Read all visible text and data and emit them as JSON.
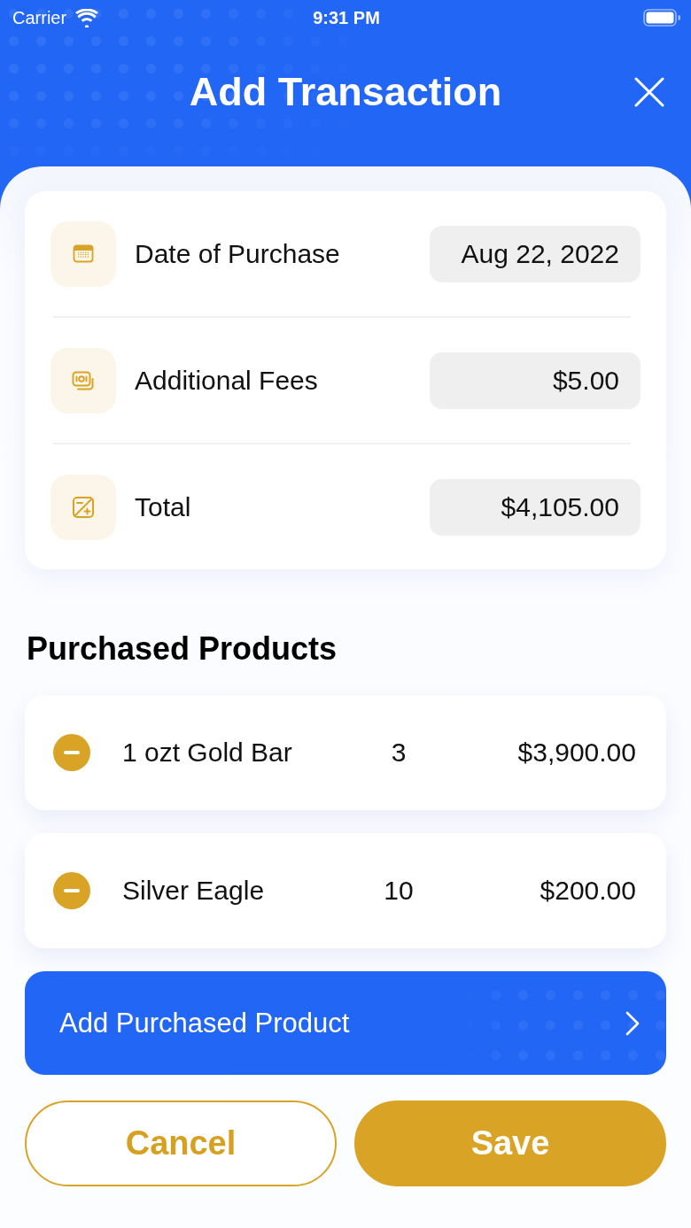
{
  "status_bar": {
    "carrier": "Carrier",
    "time": "9:31 PM"
  },
  "header": {
    "title": "Add Transaction"
  },
  "summary": [
    {
      "kind": "date",
      "label": "Date of Purchase",
      "value": "Aug 22, 2022"
    },
    {
      "kind": "fees",
      "label": "Additional Fees",
      "value": "$5.00"
    },
    {
      "kind": "total",
      "label": "Total",
      "value": "$4,105.00"
    }
  ],
  "products_section": {
    "title": "Purchased Products",
    "items": [
      {
        "name": "1 ozt Gold Bar",
        "quantity": "3",
        "price": "$3,900.00"
      },
      {
        "name": "Silver Eagle",
        "quantity": "10",
        "price": "$200.00"
      }
    ]
  },
  "add_button": {
    "label": "Add Purchased Product"
  },
  "actions": [
    {
      "kind": "secondary",
      "label": "Cancel"
    },
    {
      "kind": "primary",
      "label": "Save"
    }
  ]
}
